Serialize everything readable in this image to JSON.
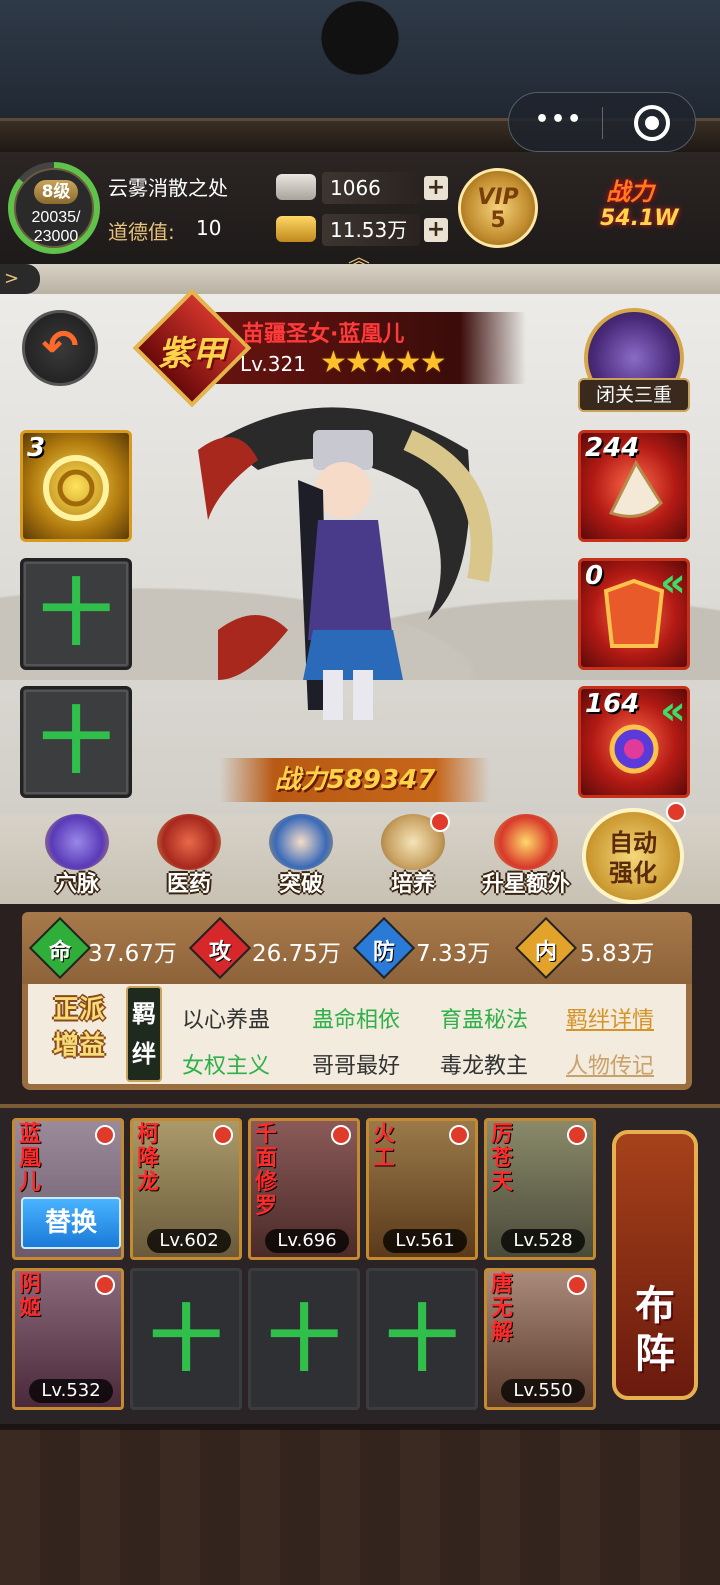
{
  "header": {
    "level_badge": "8级",
    "exp_current": "20035/",
    "exp_max": "23000",
    "player_name": "云雾消散之处",
    "morality_label": "道德值:",
    "morality_value": "10",
    "silver": "1066",
    "gold": "11.53万",
    "vip_text": "VIP",
    "vip_level": "5",
    "power_label": "战力",
    "power_value": "54.1W"
  },
  "hero": {
    "rank": "紫甲",
    "name": "苗疆圣女·蓝凰儿",
    "level": "Lv.321",
    "stars": "★★★★★",
    "meditation_label": "闭关三重",
    "power_text": "战力589347",
    "left_slots": [
      {
        "count": "3",
        "type": "gold"
      },
      {
        "count": "",
        "type": "empty"
      },
      {
        "count": "",
        "type": "empty"
      }
    ],
    "right_slots": [
      {
        "count": "244"
      },
      {
        "count": "0"
      },
      {
        "count": "164"
      }
    ]
  },
  "functions": [
    {
      "label": "穴脉",
      "icon": "meridian-icon",
      "color": "#6a5ac8"
    },
    {
      "label": "医药",
      "icon": "medicine-icon",
      "color": "#c83a2a"
    },
    {
      "label": "突破",
      "icon": "breakthrough-icon",
      "color": "#3a6ab8"
    },
    {
      "label": "培养",
      "icon": "cultivate-icon",
      "color": "#c8a060"
    },
    {
      "label": "升星额外",
      "icon": "star-up-icon",
      "color": "#d8a030"
    }
  ],
  "auto_strengthen": "自动强化",
  "stats": [
    {
      "icon": "命",
      "value": "37.67万",
      "color": "#2fae3a"
    },
    {
      "icon": "攻",
      "value": "26.75万",
      "color": "#d6282a"
    },
    {
      "icon": "防",
      "value": "7.33万",
      "color": "#2a7ad8"
    },
    {
      "icon": "内",
      "value": "5.83万",
      "color": "#e3a22a"
    }
  ],
  "faction_label": "正派增益",
  "bond_label": "羁绊",
  "bonds": [
    {
      "text": "以心养蛊",
      "style": "plain"
    },
    {
      "text": "蛊命相依",
      "style": "g"
    },
    {
      "text": "育蛊秘法",
      "style": "g"
    },
    {
      "text": "羁绊详情",
      "style": "o"
    },
    {
      "text": "女权主义",
      "style": "g"
    },
    {
      "text": "哥哥最好",
      "style": "plain"
    },
    {
      "text": "毒龙教主",
      "style": "plain"
    },
    {
      "text": "人物传记",
      "style": "l"
    }
  ],
  "team": [
    {
      "name": "蓝凰儿",
      "level": "",
      "swap": "替换",
      "bg": "#8a7a8a"
    },
    {
      "name": "柯降龙",
      "level": "Lv.602",
      "bg": "#8a7a5a"
    },
    {
      "name": "千面修罗",
      "level": "Lv.696",
      "bg": "#6a4a48"
    },
    {
      "name": "火工",
      "level": "Lv.561",
      "bg": "#7a5a3a"
    },
    {
      "name": "厉苍天",
      "level": "Lv.528",
      "bg": "#6a6a58"
    },
    {
      "name": "阴姬",
      "level": "Lv.532",
      "bg": "#6a4a5a"
    },
    {
      "name": "",
      "level": "",
      "empty": true
    },
    {
      "name": "",
      "level": "",
      "empty": true
    },
    {
      "name": "",
      "level": "",
      "empty": true
    },
    {
      "name": "唐无解",
      "level": "Lv.550",
      "bg": "#8a6a5a"
    }
  ],
  "formation_label": "布阵",
  "colors": {
    "accent_gold": "#e8c27a",
    "red": "#ff3a3a",
    "green": "#2fbf4a"
  }
}
